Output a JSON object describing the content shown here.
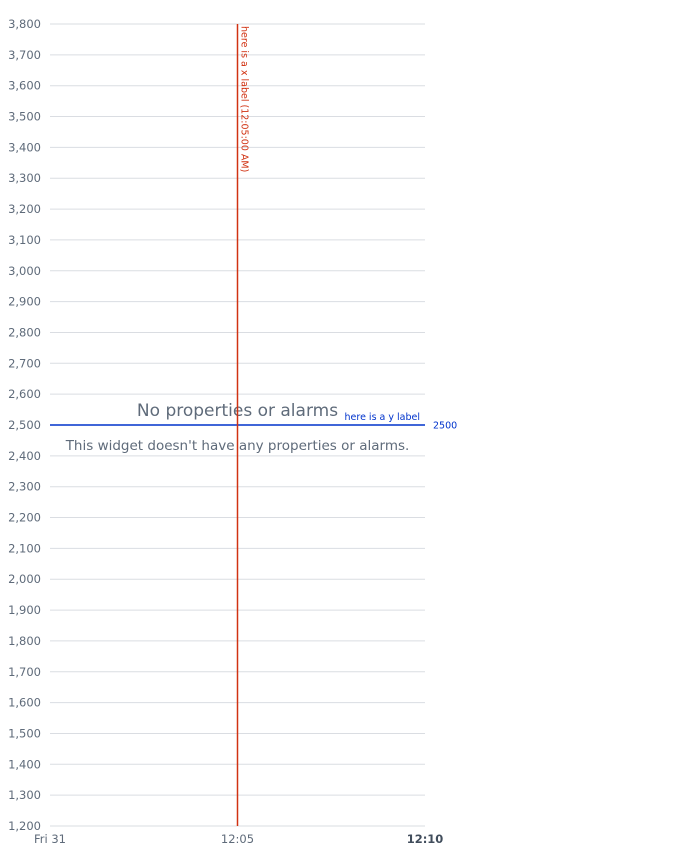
{
  "chart_data": {
    "type": "line",
    "title": "",
    "xlabel": "",
    "ylabel": "",
    "ylim": [
      1200,
      3800
    ],
    "y_ticks": [
      3800,
      3700,
      3600,
      3500,
      3400,
      3300,
      3200,
      3100,
      3000,
      2900,
      2800,
      2700,
      2600,
      2500,
      2400,
      2300,
      2200,
      2100,
      2000,
      1900,
      1800,
      1700,
      1600,
      1500,
      1400,
      1300,
      1200
    ],
    "y_tick_labels": [
      "3,800",
      "3,700",
      "3,600",
      "3,500",
      "3,400",
      "3,300",
      "3,200",
      "3,100",
      "3,000",
      "2,900",
      "2,800",
      "2,700",
      "2,600",
      "2,500",
      "2,400",
      "2,300",
      "2,200",
      "2,100",
      "2,000",
      "1,900",
      "1,800",
      "1,700",
      "1,600",
      "1,500",
      "1,400",
      "1,300",
      "1,200"
    ],
    "x_ticks": [
      {
        "label": "Fri 31",
        "value": "00:00",
        "bold": false
      },
      {
        "label": "12:05",
        "value": "00:05",
        "bold": false
      },
      {
        "label": "12:10",
        "value": "00:10",
        "bold": true
      }
    ],
    "xlim": [
      "00:00",
      "00:10"
    ],
    "grid": true,
    "series": [],
    "annotations": {
      "vertical": {
        "x": "00:05",
        "label": "here is a x label (12:05:00 AM)",
        "color": "#d13212"
      },
      "horizontal": {
        "y": 2500,
        "label": "here is a y label",
        "value_label": "2500",
        "color": "#0033cc"
      }
    },
    "empty_state": {
      "title": "No properties or alarms",
      "description": "This widget doesn't have any properties or alarms."
    }
  }
}
